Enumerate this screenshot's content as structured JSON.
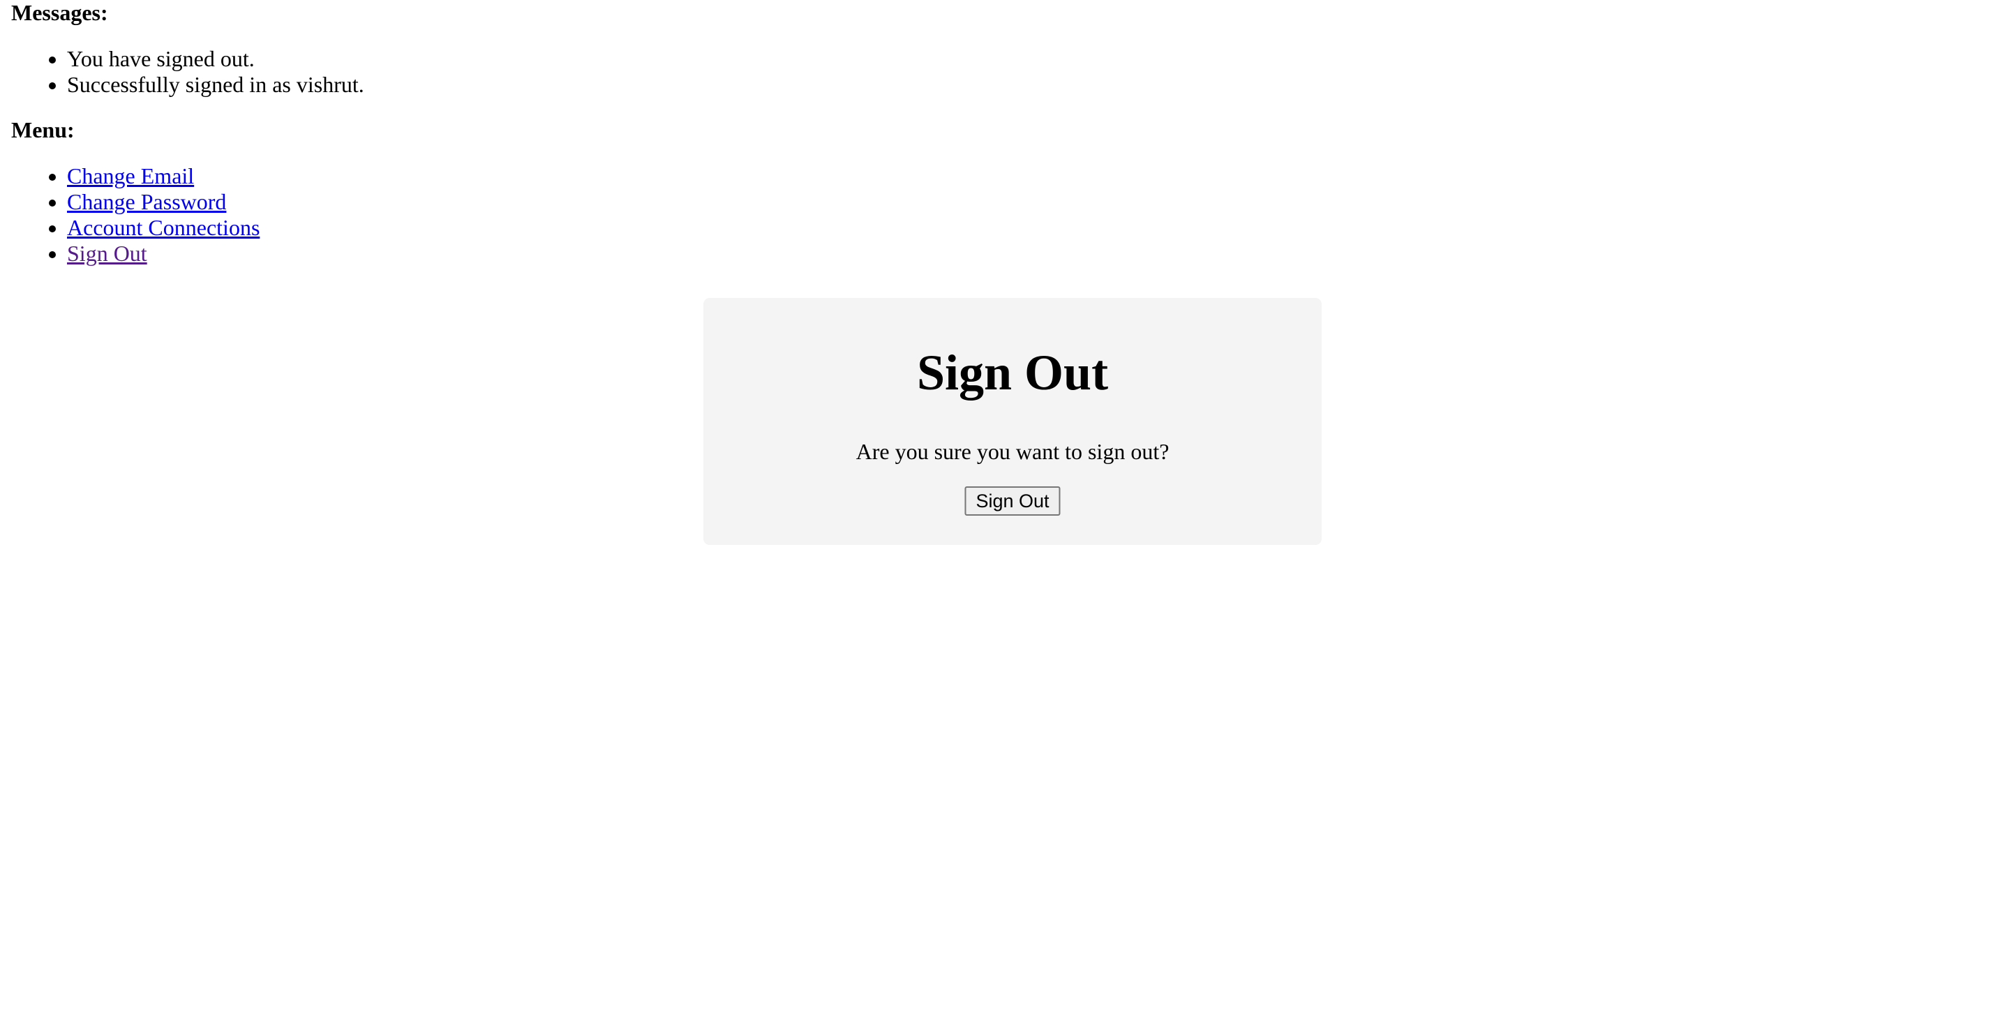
{
  "messages": {
    "heading": "Messages:",
    "items": [
      "You have signed out.",
      "Successfully signed in as vishrut."
    ]
  },
  "menu": {
    "heading": "Menu:",
    "items": [
      {
        "label": "Change Email"
      },
      {
        "label": "Change Password"
      },
      {
        "label": "Account Connections"
      },
      {
        "label": "Sign Out",
        "visited": true
      }
    ]
  },
  "signout_card": {
    "title": "Sign Out",
    "prompt": "Are you sure you want to sign out?",
    "button_label": "Sign Out"
  },
  "colors": {
    "link": "#0000ee",
    "visited_link": "#551a8b",
    "card_background": "#f4f4f4"
  }
}
